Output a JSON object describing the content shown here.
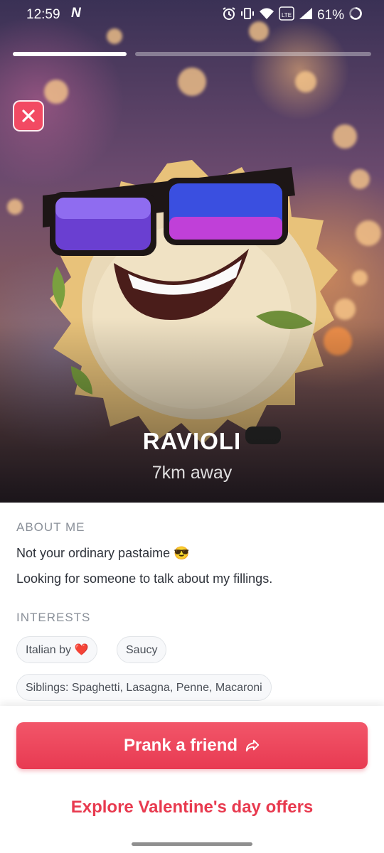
{
  "status_bar": {
    "time": "12:59",
    "notification_glyph": "N",
    "battery_percent": "61%",
    "network_badge": "LTE",
    "icons": [
      "alarm-icon",
      "vibrate-icon",
      "wifi-icon",
      "volte-icon",
      "signal-icon",
      "battery-icon"
    ]
  },
  "story_progress": {
    "segments": 2,
    "active_segment": 1
  },
  "profile": {
    "name": "RAVIOLI",
    "distance": "7km away"
  },
  "about": {
    "title": "ABOUT ME",
    "line1": "Not your ordinary pastaime 😎",
    "line2": "Looking for someone to talk about my fillings."
  },
  "interests": {
    "title": "INTERESTS",
    "chips": [
      "Italian by ❤️",
      "Saucy",
      "Siblings: Spaghetti, Lasagna, Penne, Macaroni"
    ]
  },
  "actions": {
    "prank_label": "Prank a friend",
    "offers_label": "Explore Valentine's day offers"
  },
  "colors": {
    "accent": "#e83a52",
    "chip_bg": "#f7f8fa",
    "close_button": "#f24a63"
  }
}
